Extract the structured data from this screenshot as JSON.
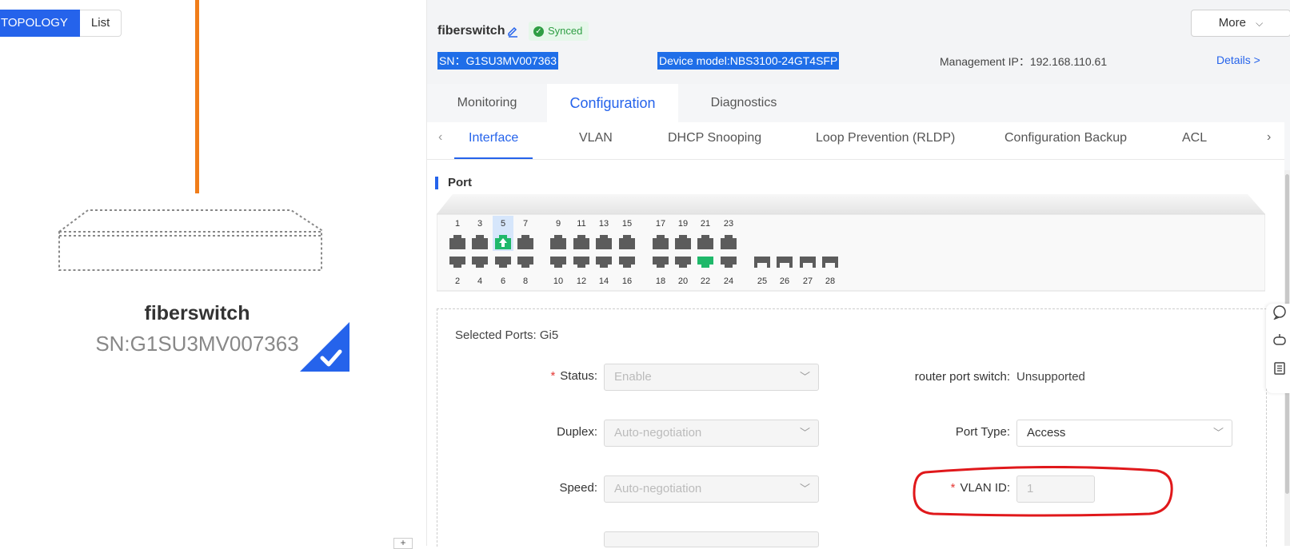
{
  "left": {
    "view_tabs": [
      "TOPOLOGY",
      "List"
    ],
    "device_name": "fiberswitch",
    "device_sn": "SN:G1SU3MV007363"
  },
  "header": {
    "title": "fiberswitch",
    "sync_status": "Synced",
    "more_label": "More",
    "sn": "SN：G1SU3MV007363",
    "model": "Device model:NBS3100-24GT4SFP",
    "mgmt_ip": "Management IP：192.168.110.61",
    "details": "Details >"
  },
  "tabs": [
    {
      "label": "Monitoring"
    },
    {
      "label": "Configuration",
      "active": true
    },
    {
      "label": "Diagnostics"
    }
  ],
  "subtabs": [
    {
      "label": "Interface",
      "active": true
    },
    {
      "label": "VLAN"
    },
    {
      "label": "DHCP Snooping"
    },
    {
      "label": "Loop Prevention (RLDP)"
    },
    {
      "label": "Configuration Backup"
    },
    {
      "label": "ACL"
    }
  ],
  "port_section": {
    "title": "Port",
    "top_ports": [
      "1",
      "3",
      "5",
      "7",
      "9",
      "11",
      "13",
      "15",
      "17",
      "19",
      "21",
      "23"
    ],
    "bottom_ports": [
      "2",
      "4",
      "6",
      "8",
      "10",
      "12",
      "14",
      "16",
      "18",
      "20",
      "22",
      "24"
    ],
    "sfp_ports": [
      "25",
      "26",
      "27",
      "28"
    ],
    "selected_port": "5",
    "uplink_port": "5",
    "active_port": "22"
  },
  "form": {
    "selected_ports": "Selected Ports: Gi5",
    "status_label": "Status:",
    "status_value": "Enable",
    "duplex_label": "Duplex:",
    "duplex_value": "Auto-negotiation",
    "speed_label": "Speed:",
    "speed_value": "Auto-negotiation",
    "router_label": "router port switch:",
    "router_value": "Unsupported",
    "port_type_label": "Port Type:",
    "port_type_value": "Access",
    "vlan_label": "VLAN ID:",
    "vlan_value": "1"
  },
  "colors": {
    "accent": "#2563eb",
    "link_orange": "#f07d1a",
    "port_gray": "#5c5c5c",
    "port_green": "#1fb86a",
    "highlight_red": "#e0181b"
  }
}
